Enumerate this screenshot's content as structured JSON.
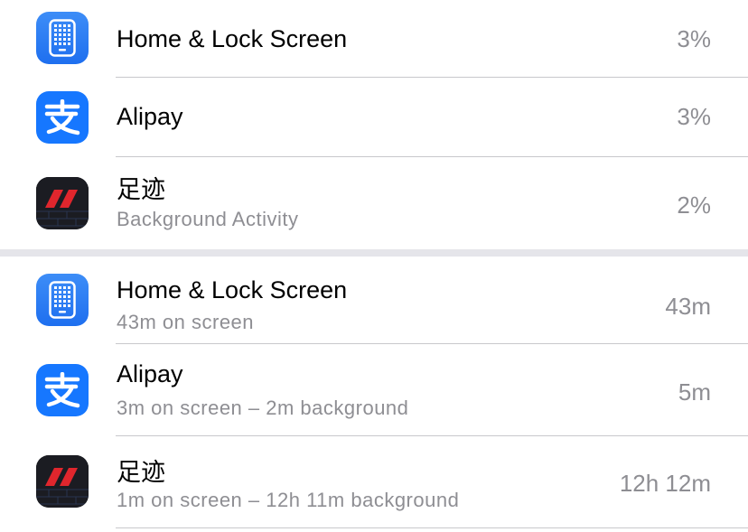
{
  "battery_usage": {
    "rows": [
      {
        "title": "Home & Lock Screen",
        "subtitle": "",
        "value": "3%",
        "icon": "home-screen-icon"
      },
      {
        "title": "Alipay",
        "subtitle": "",
        "value": "3%",
        "icon": "alipay-icon"
      },
      {
        "title": "足迹",
        "subtitle": "Background Activity",
        "value": "2%",
        "icon": "footprint-app-icon"
      }
    ]
  },
  "activity": {
    "rows": [
      {
        "title": "Home & Lock Screen",
        "subtitle": "43m on screen",
        "value": "43m",
        "icon": "home-screen-icon"
      },
      {
        "title": "Alipay",
        "subtitle": "3m on screen – 2m background",
        "value": "5m",
        "icon": "alipay-icon"
      },
      {
        "title": "足迹",
        "subtitle": "1m on screen – 12h 11m background",
        "value": "12h 12m",
        "icon": "footprint-app-icon"
      }
    ]
  },
  "colors": {
    "accent_blue": "#1677ff",
    "secondary_text": "#8e8e93",
    "separator": "#c8c8cc"
  }
}
